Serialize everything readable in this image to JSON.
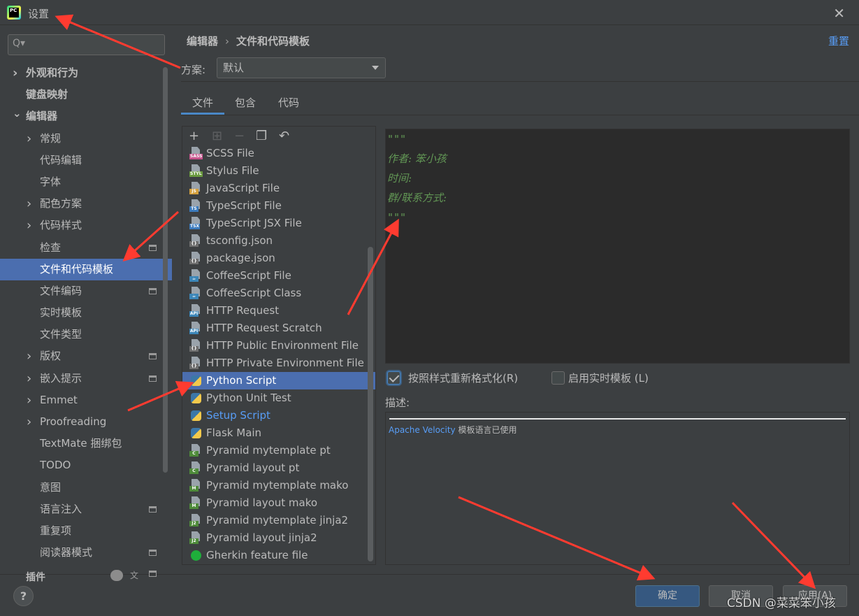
{
  "window": {
    "title": "设置",
    "logo_text": "PC"
  },
  "search": {
    "placeholder": ""
  },
  "settings_tree": [
    {
      "label": "外观和行为",
      "level": 0,
      "expandable": true,
      "expanded": false,
      "bold": true,
      "has_setting_icon": false,
      "selected": false
    },
    {
      "label": "键盘映射",
      "level": 0,
      "expandable": false,
      "expanded": false,
      "bold": true,
      "has_setting_icon": false,
      "selected": false
    },
    {
      "label": "编辑器",
      "level": 0,
      "expandable": true,
      "expanded": true,
      "bold": true,
      "has_setting_icon": false,
      "selected": false
    },
    {
      "label": "常规",
      "level": 1,
      "expandable": true,
      "expanded": false,
      "bold": false,
      "has_setting_icon": false,
      "selected": false
    },
    {
      "label": "代码编辑",
      "level": 1,
      "expandable": false,
      "expanded": false,
      "bold": false,
      "has_setting_icon": false,
      "selected": false
    },
    {
      "label": "字体",
      "level": 1,
      "expandable": false,
      "expanded": false,
      "bold": false,
      "has_setting_icon": false,
      "selected": false
    },
    {
      "label": "配色方案",
      "level": 1,
      "expandable": true,
      "expanded": false,
      "bold": false,
      "has_setting_icon": false,
      "selected": false
    },
    {
      "label": "代码样式",
      "level": 1,
      "expandable": true,
      "expanded": false,
      "bold": false,
      "has_setting_icon": false,
      "selected": false
    },
    {
      "label": "检查",
      "level": 1,
      "expandable": false,
      "expanded": false,
      "bold": false,
      "has_setting_icon": true,
      "selected": false
    },
    {
      "label": "文件和代码模板",
      "level": 1,
      "expandable": false,
      "expanded": false,
      "bold": false,
      "has_setting_icon": false,
      "selected": true
    },
    {
      "label": "文件编码",
      "level": 1,
      "expandable": false,
      "expanded": false,
      "bold": false,
      "has_setting_icon": true,
      "selected": false
    },
    {
      "label": "实时模板",
      "level": 1,
      "expandable": false,
      "expanded": false,
      "bold": false,
      "has_setting_icon": false,
      "selected": false
    },
    {
      "label": "文件类型",
      "level": 1,
      "expandable": false,
      "expanded": false,
      "bold": false,
      "has_setting_icon": false,
      "selected": false
    },
    {
      "label": "版权",
      "level": 1,
      "expandable": true,
      "expanded": false,
      "bold": false,
      "has_setting_icon": true,
      "selected": false
    },
    {
      "label": "嵌入提示",
      "level": 1,
      "expandable": true,
      "expanded": false,
      "bold": false,
      "has_setting_icon": true,
      "selected": false
    },
    {
      "label": "Emmet",
      "level": 1,
      "expandable": true,
      "expanded": false,
      "bold": false,
      "has_setting_icon": false,
      "selected": false
    },
    {
      "label": "Proofreading",
      "level": 1,
      "expandable": true,
      "expanded": false,
      "bold": false,
      "has_setting_icon": false,
      "selected": false
    },
    {
      "label": "TextMate 捆绑包",
      "level": 1,
      "expandable": false,
      "expanded": false,
      "bold": false,
      "has_setting_icon": false,
      "selected": false
    },
    {
      "label": "TODO",
      "level": 1,
      "expandable": false,
      "expanded": false,
      "bold": false,
      "has_setting_icon": false,
      "selected": false
    },
    {
      "label": "意图",
      "level": 1,
      "expandable": false,
      "expanded": false,
      "bold": false,
      "has_setting_icon": false,
      "selected": false
    },
    {
      "label": "语言注入",
      "level": 1,
      "expandable": false,
      "expanded": false,
      "bold": false,
      "has_setting_icon": true,
      "selected": false
    },
    {
      "label": "重复项",
      "level": 1,
      "expandable": false,
      "expanded": false,
      "bold": false,
      "has_setting_icon": false,
      "selected": false
    },
    {
      "label": "阅读器模式",
      "level": 1,
      "expandable": false,
      "expanded": false,
      "bold": false,
      "has_setting_icon": true,
      "selected": false
    }
  ],
  "settings_tree_partial": {
    "label": "插件",
    "badge_icon": "update-count-badge",
    "lang_icon": "translate-icon"
  },
  "breadcrumb": [
    "编辑器",
    "文件和代码模板"
  ],
  "breadcrumb_separator": "›",
  "reset_label": "重置",
  "scheme": {
    "label": "方案:",
    "value": "默认"
  },
  "tabs": [
    {
      "label": "文件",
      "active": true
    },
    {
      "label": "包含",
      "active": false
    },
    {
      "label": "代码",
      "active": false
    }
  ],
  "toolbar_icons": [
    "add-icon",
    "add-child-icon",
    "remove-icon",
    "copy-icon",
    "revert-icon"
  ],
  "toolbar_glyphs": [
    "+",
    "⊞",
    "−",
    "❐",
    "↶"
  ],
  "templates": [
    {
      "name": "SCSS File",
      "icon": "sass",
      "tag": "SASS",
      "color": "#c6538c"
    },
    {
      "name": "Stylus File",
      "icon": "stylus",
      "tag": "STYL",
      "color": "#6a9a3f"
    },
    {
      "name": "JavaScript File",
      "icon": "js",
      "tag": "JS",
      "color": "#d4a03e"
    },
    {
      "name": "TypeScript File",
      "icon": "ts",
      "tag": "TS",
      "color": "#3c7bbd"
    },
    {
      "name": "TypeScript JSX File",
      "icon": "tsx",
      "tag": "TSX",
      "color": "#3c7bbd"
    },
    {
      "name": "tsconfig.json",
      "icon": "json",
      "tag": "{}",
      "color": "#6e6e6e"
    },
    {
      "name": "package.json",
      "icon": "json",
      "tag": "{}",
      "color": "#6e6e6e"
    },
    {
      "name": "CoffeeScript File",
      "icon": "coffee",
      "tag": "☕",
      "color": "#3c86b8"
    },
    {
      "name": "CoffeeScript Class",
      "icon": "coffee",
      "tag": "☕",
      "color": "#3c86b8"
    },
    {
      "name": "HTTP Request",
      "icon": "api",
      "tag": "API",
      "color": "#3c86b8"
    },
    {
      "name": "HTTP Request Scratch",
      "icon": "api",
      "tag": "API",
      "color": "#3c86b8"
    },
    {
      "name": "HTTP Public Environment File",
      "icon": "json",
      "tag": "{}",
      "color": "#6e6e6e"
    },
    {
      "name": "HTTP Private Environment File",
      "icon": "json",
      "tag": "{}",
      "color": "#6e6e6e"
    },
    {
      "name": "Python Script",
      "icon": "python",
      "tag": "py",
      "color": "#3b77a8",
      "selected": true
    },
    {
      "name": "Python Unit Test",
      "icon": "python",
      "tag": "py",
      "color": "#3b77a8"
    },
    {
      "name": "Setup Script",
      "icon": "python",
      "tag": "py",
      "color": "#3b77a8",
      "link": true
    },
    {
      "name": "Flask Main",
      "icon": "python",
      "tag": "py",
      "color": "#3b77a8"
    },
    {
      "name": "Pyramid mytemplate pt",
      "icon": "chameleon",
      "tag": "C",
      "color": "#4e8a3a"
    },
    {
      "name": "Pyramid layout pt",
      "icon": "chameleon",
      "tag": "C",
      "color": "#4e8a3a"
    },
    {
      "name": "Pyramid mytemplate mako",
      "icon": "mako",
      "tag": "M",
      "color": "#4e8a3a"
    },
    {
      "name": "Pyramid layout mako",
      "icon": "mako",
      "tag": "M",
      "color": "#4e8a3a"
    },
    {
      "name": "Pyramid mytemplate jinja2",
      "icon": "jinja",
      "tag": "J2",
      "color": "#4e8a3a"
    },
    {
      "name": "Pyramid layout jinja2",
      "icon": "jinja",
      "tag": "J2",
      "color": "#4e8a3a"
    },
    {
      "name": "Gherkin feature file",
      "icon": "gherkin",
      "tag": "",
      "color": "#1fae3b"
    }
  ],
  "editor_lines": [
    "\"\"\"",
    "作者: 笨小孩",
    "时间:",
    "群/联系方式:",
    "\"\"\""
  ],
  "options": {
    "reformat": {
      "label": "按照样式重新格式化(R)",
      "checked": true
    },
    "live_template": {
      "label": "启用实时模板 (L)",
      "checked": false
    }
  },
  "description": {
    "label": "描述:",
    "link_text": "Apache Velocity",
    "text": " 模板语言已使用"
  },
  "buttons": {
    "help": "?",
    "ok": "确定",
    "cancel": "取消",
    "apply": "应用(A)"
  },
  "watermark": "CSDN @菜菜笨小孩",
  "colors": {
    "selection": "#4b6eaf",
    "link": "#589df6",
    "comment_green": "#629755",
    "annotation_arrow": "#ff3b30"
  }
}
